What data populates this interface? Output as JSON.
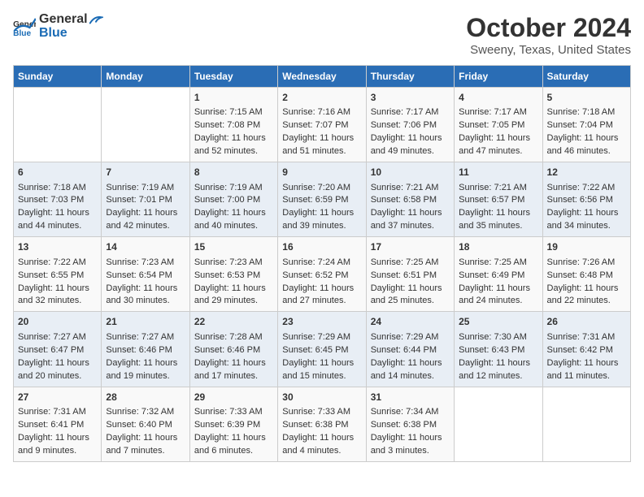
{
  "header": {
    "logo_general": "General",
    "logo_blue": "Blue",
    "month": "October 2024",
    "location": "Sweeny, Texas, United States"
  },
  "days_of_week": [
    "Sunday",
    "Monday",
    "Tuesday",
    "Wednesday",
    "Thursday",
    "Friday",
    "Saturday"
  ],
  "weeks": [
    [
      {
        "day": "",
        "sunrise": "",
        "sunset": "",
        "daylight": ""
      },
      {
        "day": "",
        "sunrise": "",
        "sunset": "",
        "daylight": ""
      },
      {
        "day": "1",
        "sunrise": "Sunrise: 7:15 AM",
        "sunset": "Sunset: 7:08 PM",
        "daylight": "Daylight: 11 hours and 52 minutes."
      },
      {
        "day": "2",
        "sunrise": "Sunrise: 7:16 AM",
        "sunset": "Sunset: 7:07 PM",
        "daylight": "Daylight: 11 hours and 51 minutes."
      },
      {
        "day": "3",
        "sunrise": "Sunrise: 7:17 AM",
        "sunset": "Sunset: 7:06 PM",
        "daylight": "Daylight: 11 hours and 49 minutes."
      },
      {
        "day": "4",
        "sunrise": "Sunrise: 7:17 AM",
        "sunset": "Sunset: 7:05 PM",
        "daylight": "Daylight: 11 hours and 47 minutes."
      },
      {
        "day": "5",
        "sunrise": "Sunrise: 7:18 AM",
        "sunset": "Sunset: 7:04 PM",
        "daylight": "Daylight: 11 hours and 46 minutes."
      }
    ],
    [
      {
        "day": "6",
        "sunrise": "Sunrise: 7:18 AM",
        "sunset": "Sunset: 7:03 PM",
        "daylight": "Daylight: 11 hours and 44 minutes."
      },
      {
        "day": "7",
        "sunrise": "Sunrise: 7:19 AM",
        "sunset": "Sunset: 7:01 PM",
        "daylight": "Daylight: 11 hours and 42 minutes."
      },
      {
        "day": "8",
        "sunrise": "Sunrise: 7:19 AM",
        "sunset": "Sunset: 7:00 PM",
        "daylight": "Daylight: 11 hours and 40 minutes."
      },
      {
        "day": "9",
        "sunrise": "Sunrise: 7:20 AM",
        "sunset": "Sunset: 6:59 PM",
        "daylight": "Daylight: 11 hours and 39 minutes."
      },
      {
        "day": "10",
        "sunrise": "Sunrise: 7:21 AM",
        "sunset": "Sunset: 6:58 PM",
        "daylight": "Daylight: 11 hours and 37 minutes."
      },
      {
        "day": "11",
        "sunrise": "Sunrise: 7:21 AM",
        "sunset": "Sunset: 6:57 PM",
        "daylight": "Daylight: 11 hours and 35 minutes."
      },
      {
        "day": "12",
        "sunrise": "Sunrise: 7:22 AM",
        "sunset": "Sunset: 6:56 PM",
        "daylight": "Daylight: 11 hours and 34 minutes."
      }
    ],
    [
      {
        "day": "13",
        "sunrise": "Sunrise: 7:22 AM",
        "sunset": "Sunset: 6:55 PM",
        "daylight": "Daylight: 11 hours and 32 minutes."
      },
      {
        "day": "14",
        "sunrise": "Sunrise: 7:23 AM",
        "sunset": "Sunset: 6:54 PM",
        "daylight": "Daylight: 11 hours and 30 minutes."
      },
      {
        "day": "15",
        "sunrise": "Sunrise: 7:23 AM",
        "sunset": "Sunset: 6:53 PM",
        "daylight": "Daylight: 11 hours and 29 minutes."
      },
      {
        "day": "16",
        "sunrise": "Sunrise: 7:24 AM",
        "sunset": "Sunset: 6:52 PM",
        "daylight": "Daylight: 11 hours and 27 minutes."
      },
      {
        "day": "17",
        "sunrise": "Sunrise: 7:25 AM",
        "sunset": "Sunset: 6:51 PM",
        "daylight": "Daylight: 11 hours and 25 minutes."
      },
      {
        "day": "18",
        "sunrise": "Sunrise: 7:25 AM",
        "sunset": "Sunset: 6:49 PM",
        "daylight": "Daylight: 11 hours and 24 minutes."
      },
      {
        "day": "19",
        "sunrise": "Sunrise: 7:26 AM",
        "sunset": "Sunset: 6:48 PM",
        "daylight": "Daylight: 11 hours and 22 minutes."
      }
    ],
    [
      {
        "day": "20",
        "sunrise": "Sunrise: 7:27 AM",
        "sunset": "Sunset: 6:47 PM",
        "daylight": "Daylight: 11 hours and 20 minutes."
      },
      {
        "day": "21",
        "sunrise": "Sunrise: 7:27 AM",
        "sunset": "Sunset: 6:46 PM",
        "daylight": "Daylight: 11 hours and 19 minutes."
      },
      {
        "day": "22",
        "sunrise": "Sunrise: 7:28 AM",
        "sunset": "Sunset: 6:46 PM",
        "daylight": "Daylight: 11 hours and 17 minutes."
      },
      {
        "day": "23",
        "sunrise": "Sunrise: 7:29 AM",
        "sunset": "Sunset: 6:45 PM",
        "daylight": "Daylight: 11 hours and 15 minutes."
      },
      {
        "day": "24",
        "sunrise": "Sunrise: 7:29 AM",
        "sunset": "Sunset: 6:44 PM",
        "daylight": "Daylight: 11 hours and 14 minutes."
      },
      {
        "day": "25",
        "sunrise": "Sunrise: 7:30 AM",
        "sunset": "Sunset: 6:43 PM",
        "daylight": "Daylight: 11 hours and 12 minutes."
      },
      {
        "day": "26",
        "sunrise": "Sunrise: 7:31 AM",
        "sunset": "Sunset: 6:42 PM",
        "daylight": "Daylight: 11 hours and 11 minutes."
      }
    ],
    [
      {
        "day": "27",
        "sunrise": "Sunrise: 7:31 AM",
        "sunset": "Sunset: 6:41 PM",
        "daylight": "Daylight: 11 hours and 9 minutes."
      },
      {
        "day": "28",
        "sunrise": "Sunrise: 7:32 AM",
        "sunset": "Sunset: 6:40 PM",
        "daylight": "Daylight: 11 hours and 7 minutes."
      },
      {
        "day": "29",
        "sunrise": "Sunrise: 7:33 AM",
        "sunset": "Sunset: 6:39 PM",
        "daylight": "Daylight: 11 hours and 6 minutes."
      },
      {
        "day": "30",
        "sunrise": "Sunrise: 7:33 AM",
        "sunset": "Sunset: 6:38 PM",
        "daylight": "Daylight: 11 hours and 4 minutes."
      },
      {
        "day": "31",
        "sunrise": "Sunrise: 7:34 AM",
        "sunset": "Sunset: 6:38 PM",
        "daylight": "Daylight: 11 hours and 3 minutes."
      },
      {
        "day": "",
        "sunrise": "",
        "sunset": "",
        "daylight": ""
      },
      {
        "day": "",
        "sunrise": "",
        "sunset": "",
        "daylight": ""
      }
    ]
  ]
}
